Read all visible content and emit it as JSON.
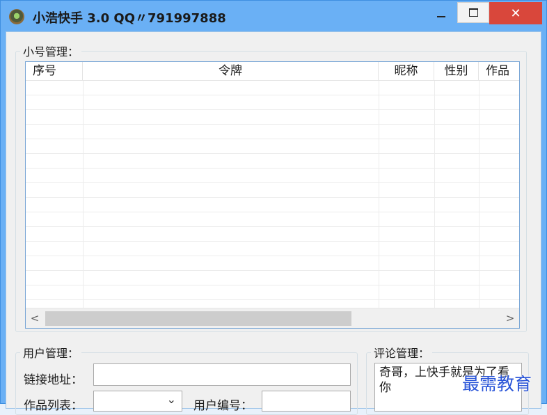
{
  "window": {
    "title": "小浩快手 3.0 QQ〃791997888",
    "close_glyph": "✕"
  },
  "accounts": {
    "legend": "小号管理：",
    "columns": [
      "序号",
      "令牌",
      "昵称",
      "性别",
      "作品"
    ],
    "rows": [],
    "scroll_left": "<",
    "scroll_right": ">"
  },
  "user": {
    "legend": "用户管理：",
    "link_label": "链接地址：",
    "link_value": "",
    "works_label": "作品列表：",
    "works_value": "",
    "works_arrow": "⌄",
    "uid_label": "用户编号：",
    "uid_value": ""
  },
  "comment": {
    "legend": "评论管理：",
    "text": "奇哥，上快手就是为了看你"
  },
  "watermark": "最需教育"
}
